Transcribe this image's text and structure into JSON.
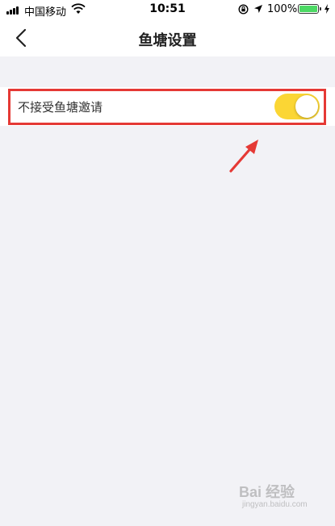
{
  "status_bar": {
    "carrier": "中国移动",
    "time": "10:51",
    "battery": "100%",
    "icons": [
      "signal-icon",
      "wifi-icon",
      "rotation-lock-icon",
      "location-icon",
      "battery-icon",
      "charging-icon"
    ]
  },
  "nav": {
    "title": "鱼塘设置",
    "back_icon": "chevron-left-icon"
  },
  "settings": {
    "reject_invite_label": "不接受鱼塘邀请",
    "reject_invite_enabled": true
  },
  "colors": {
    "toggle_on": "#fbd634",
    "highlight": "#e53935",
    "background": "#f2f2f6",
    "battery": "#4cd964"
  },
  "watermark": {
    "text": "Bai 经验",
    "sub": "jingyan.baidu.com"
  }
}
